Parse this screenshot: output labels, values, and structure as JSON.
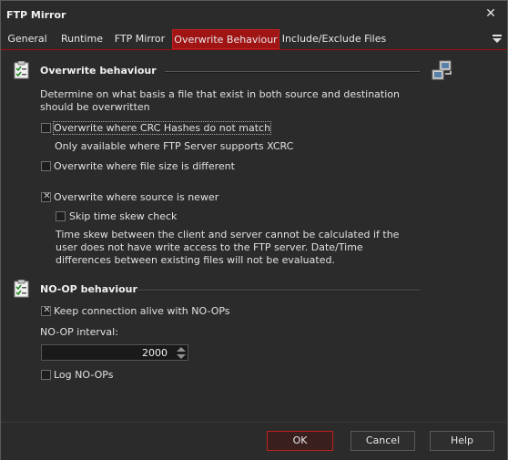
{
  "window": {
    "title": "FTP Mirror"
  },
  "tabs": [
    {
      "label": "General",
      "active": false
    },
    {
      "label": "Runtime",
      "active": false
    },
    {
      "label": "FTP Mirror",
      "active": false
    },
    {
      "label": "Overwrite Behaviour",
      "active": true
    },
    {
      "label": "Include/Exclude Files",
      "active": false
    }
  ],
  "overwrite": {
    "heading": "Overwrite behaviour",
    "description": "Determine on what basis a file that exist in both source and destination should be overwritten",
    "crc": {
      "label": "Overwrite where CRC Hashes do not match",
      "checked": false
    },
    "crc_note": "Only available where FTP Server supports XCRC",
    "size": {
      "label": "Overwrite where file size is different",
      "checked": false
    },
    "newer": {
      "label": "Overwrite where source is newer",
      "checked": true
    },
    "skew": {
      "label": "Skip time skew check",
      "checked": false
    },
    "skew_note": "Time skew between the client and server cannot be calculated if the user does not have write access to the FTP server. Date/Time differences between existing files will not be evaluated."
  },
  "noop": {
    "heading": "NO-OP behaviour",
    "keepalive": {
      "label": "Keep connection alive with NO-OPs",
      "checked": true
    },
    "interval_label": "NO-OP interval:",
    "interval_value": "2000",
    "log": {
      "label": "Log NO-OPs",
      "checked": false
    }
  },
  "buttons": {
    "ok": "OK",
    "cancel": "Cancel",
    "help": "Help"
  },
  "colors": {
    "accent": "#a01414",
    "background": "#2b2b2b"
  }
}
